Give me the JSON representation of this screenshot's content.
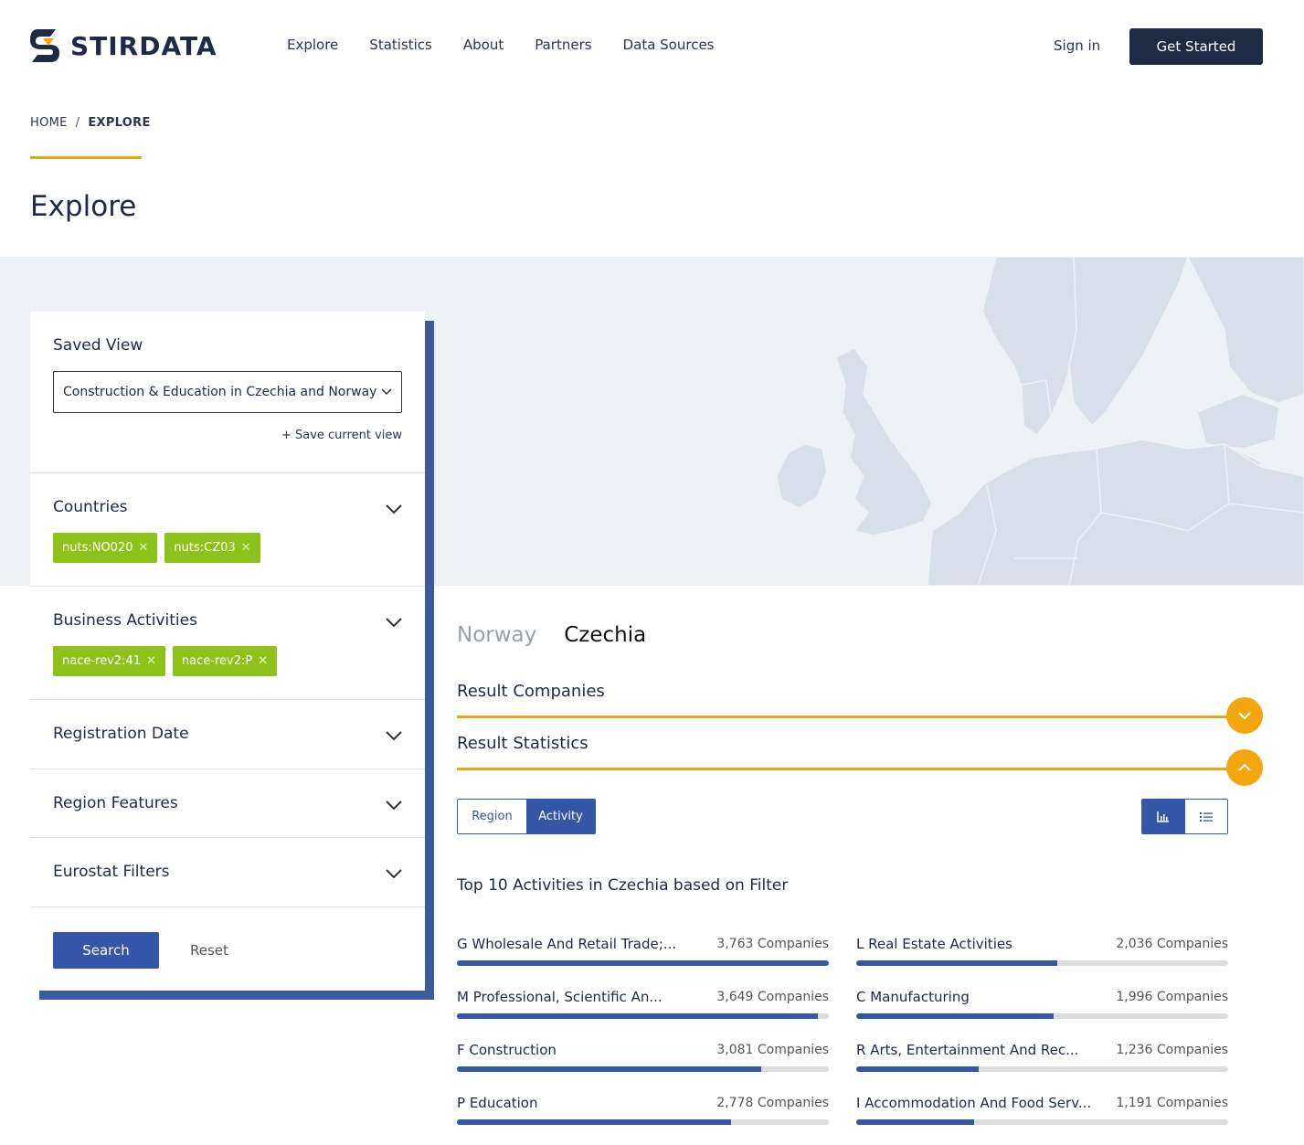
{
  "header": {
    "brand": "STIRDATA",
    "nav": [
      "Explore",
      "Statistics",
      "About",
      "Partners",
      "Data Sources"
    ],
    "sign_in": "Sign in",
    "cta": "Get Started"
  },
  "breadcrumb": {
    "home": "HOME",
    "separator": "/",
    "current": "EXPLORE"
  },
  "page_title": "Explore",
  "filters": {
    "saved_view_title": "Saved View",
    "saved_view_value": "Construction & Education in Czechia and Norway",
    "save_current": "+ Save current view",
    "countries_title": "Countries",
    "countries_chips": [
      "nuts:NO020",
      "nuts:CZ03"
    ],
    "activities_title": "Business Activities",
    "activities_chips": [
      "nace-rev2:41",
      "nace-rev2:P"
    ],
    "registration_title": "Registration Date",
    "region_title": "Region Features",
    "eurostat_title": "Eurostat Filters",
    "search": "Search",
    "reset": "Reset"
  },
  "results": {
    "tabs": [
      "Norway",
      "Czechia"
    ],
    "active_tab": "Czechia",
    "companies_title": "Result Companies",
    "statistics_title": "Result Statistics",
    "toggle": [
      "Region",
      "Activity"
    ],
    "top_title": "Top 10 Activities in Czechia based on Filter",
    "activities": [
      {
        "name": "G Wholesale And Retail Trade;...",
        "count": "3,763 Companies",
        "value": 3763
      },
      {
        "name": "L Real Estate Activities",
        "count": "2,036 Companies",
        "value": 2036
      },
      {
        "name": "M Professional, Scientific An...",
        "count": "3,649 Companies",
        "value": 3649
      },
      {
        "name": "C Manufacturing",
        "count": "1,996 Companies",
        "value": 1996
      },
      {
        "name": "F Construction",
        "count": "3,081 Companies",
        "value": 3081
      },
      {
        "name": "R Arts, Entertainment And Rec...",
        "count": "1,236 Companies",
        "value": 1236
      },
      {
        "name": "P Education",
        "count": "2,778 Companies",
        "value": 2778
      },
      {
        "name": "I Accommodation And Food Serv...",
        "count": "1,191 Companies",
        "value": 1191
      }
    ],
    "max_value": 3763
  },
  "colors": {
    "brand_dark": "#1f2a44",
    "accent": "#e6a817",
    "primary": "#3456a8",
    "chip": "#8cc21a"
  }
}
